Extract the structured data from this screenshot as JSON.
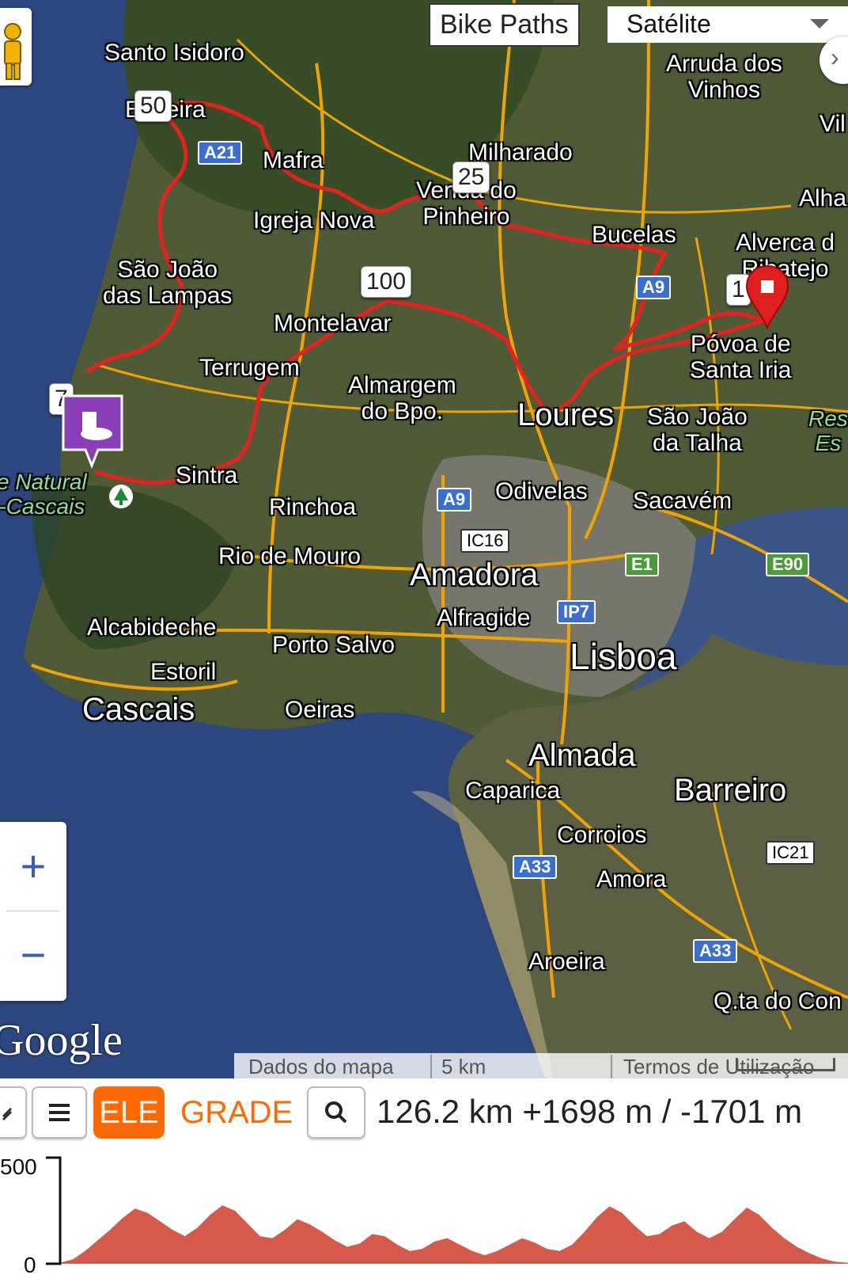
{
  "map": {
    "overlay_button": "Bike Paths",
    "map_type": "Satélite",
    "pegman_icon": "pegman-icon",
    "expand_icon": "chevron-right-icon",
    "zoom_in": "+",
    "zoom_out": "−",
    "google_logo": "Google",
    "footer": {
      "map_data": "Dados do mapa",
      "scale": "5 km",
      "terms": "Termos de Utilização"
    },
    "places": {
      "santo_isidoro": "Santo Isidoro",
      "ericeira": "Ericeira",
      "arruda": "Arruda dos\nVinhos",
      "vila": "Vil",
      "milharado": "Milharado",
      "mafra": "Mafra",
      "venda_pinheiro": "Venda do\nPinheiro",
      "igreja_nova": "Igreja Nova",
      "alha": "Alha",
      "bucelas": "Bucelas",
      "alverca": "Alverca d\nRibatejo",
      "sao_joao_lampas": "São João\ndas Lampas",
      "montelavar": "Montelavar",
      "povoa": "Póvoa de\nSanta Iria",
      "terrugem": "Terrugem",
      "almargem": "Almargem\ndo Bpo.",
      "loures": "Loures",
      "sao_joao_talha": "São João\nda Talha",
      "res": "Res\nEs",
      "parque": "e Natural\n-Cascais",
      "sintra": "Sintra",
      "odivelas": "Odivelas",
      "sacavem": "Sacavém",
      "rinchoa": "Rinchoa",
      "rio_mouro": "Rio de Mouro",
      "amadora": "Amadora",
      "alfragide": "Alfragide",
      "lisboa": "Lisboa",
      "alcabideche": "Alcabideche",
      "porto_salvo": "Porto Salvo",
      "estoril": "Estoril",
      "cascais": "Cascais",
      "oeiras": "Oeiras",
      "almada": "Almada",
      "caparica": "Caparica",
      "barreiro": "Barreiro",
      "corroios": "Corroios",
      "amora": "Amora",
      "aroeira": "Aroeira",
      "qta": "Q.ta do Con"
    },
    "roads": {
      "a21": "A21",
      "a9a": "A9",
      "a9b": "A9",
      "ic16": "IC16",
      "e1": "E1",
      "e90": "E90",
      "ip7": "IP7",
      "a33a": "A33",
      "a33b": "A33",
      "ic21": "IC21"
    },
    "distance_markers": {
      "m50": "50",
      "m25": "25",
      "m100": "100",
      "m1": "1",
      "m7": "7"
    },
    "route_color": "#e8201e",
    "poi_icon": "cafe-icon",
    "tree_icon": "tree-icon",
    "end_marker_icon": "end-marker-icon"
  },
  "toolbar": {
    "back_icon": "back-icon",
    "menu_icon": "menu-icon",
    "ele_label": "ELE",
    "grade_label": "GRADE",
    "zoom_icon": "magnifier-icon",
    "stats": "126.2 km +1698 m / -1701 m"
  },
  "chart_data": {
    "type": "area",
    "title": "",
    "xlabel": "",
    "ylabel": "",
    "y_tick_labels": [
      "500",
      "0"
    ],
    "ylim": [
      0,
      500
    ],
    "x": [
      0,
      2,
      4,
      6,
      8,
      10,
      12,
      14,
      16,
      18,
      20,
      22,
      24,
      26,
      28,
      30,
      32,
      34,
      36,
      38,
      40,
      42,
      44,
      46,
      48,
      50,
      52,
      54,
      56,
      58,
      60,
      62,
      64,
      66,
      68,
      70,
      72,
      74,
      76,
      78,
      80,
      82,
      84,
      86,
      88,
      90,
      92,
      94,
      96,
      98,
      100,
      102,
      104,
      106,
      108,
      110,
      112,
      114,
      116,
      118,
      120,
      122,
      124,
      126.2
    ],
    "series": [
      {
        "values": [
          5,
          20,
          60,
          110,
          160,
          215,
          260,
          240,
          200,
          160,
          130,
          170,
          230,
          275,
          250,
          190,
          130,
          120,
          160,
          210,
          185,
          150,
          110,
          80,
          95,
          140,
          130,
          90,
          60,
          70,
          105,
          120,
          90,
          60,
          40,
          60,
          90,
          120,
          100,
          70,
          60,
          90,
          150,
          220,
          270,
          240,
          180,
          130,
          140,
          180,
          200,
          150,
          120,
          150,
          210,
          265,
          230,
          170,
          120,
          80,
          50,
          25,
          10,
          5
        ],
        "color": "#d65a4a"
      }
    ]
  }
}
